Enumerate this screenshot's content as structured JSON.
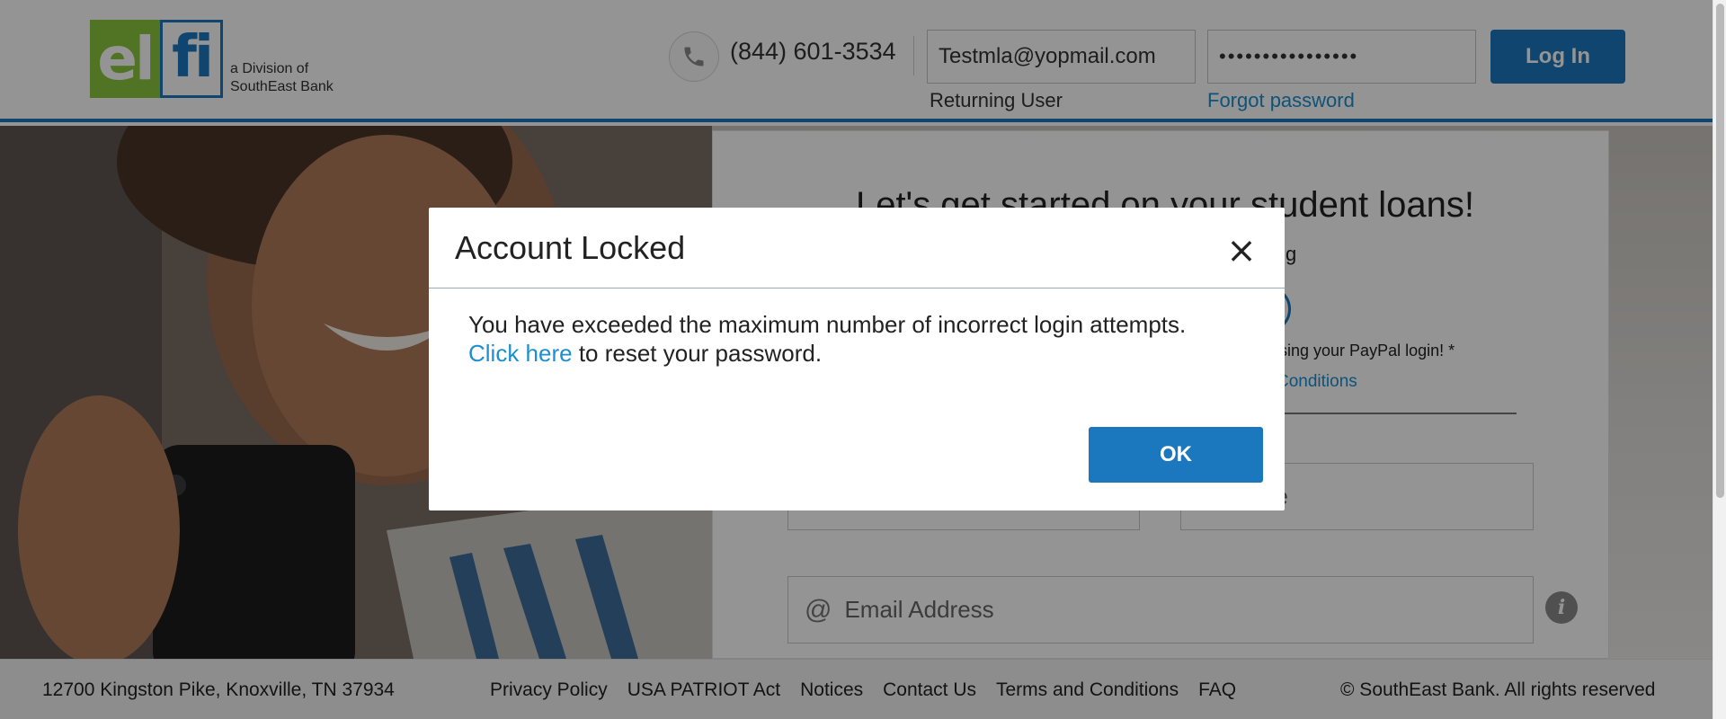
{
  "header": {
    "logo": {
      "left_text": "el",
      "right_text": "fi",
      "tagline_line1": "a Division of",
      "tagline_line2": "SouthEast Bank"
    },
    "phone": "(844) 601-3534",
    "email_value": "Testmla@yopmail.com",
    "password_value": "••••••••••••••••",
    "returning_user_label": "Returning User",
    "forgot_password_label": "Forgot password",
    "login_button": "Log In"
  },
  "main": {
    "card_title": "Let's get started on your student loans!",
    "partial_sub": "g",
    "paypal_note": "l using your PayPal login! *",
    "conditions_link": "Conditions",
    "last_name_partial": "ne",
    "email_placeholder": "Email Address"
  },
  "footer": {
    "address": "12700 Kingston Pike, Knoxville, TN 37934",
    "links": [
      "Privacy Policy",
      "USA PATRIOT Act",
      "Notices",
      "Contact Us",
      "Terms and Conditions",
      "FAQ"
    ],
    "copyright": "© SouthEast Bank. All rights reserved"
  },
  "modal": {
    "title": "Account Locked",
    "close_symbol": "×",
    "message": "You have exceeded the maximum number of incorrect login attempts.",
    "link_text": "Click here",
    "message_suffix": " to reset your password.",
    "ok_button": "OK"
  },
  "colors": {
    "brand_blue": "#1b78be",
    "link_blue": "#1b8fd0",
    "logo_green": "#8cc63f"
  }
}
